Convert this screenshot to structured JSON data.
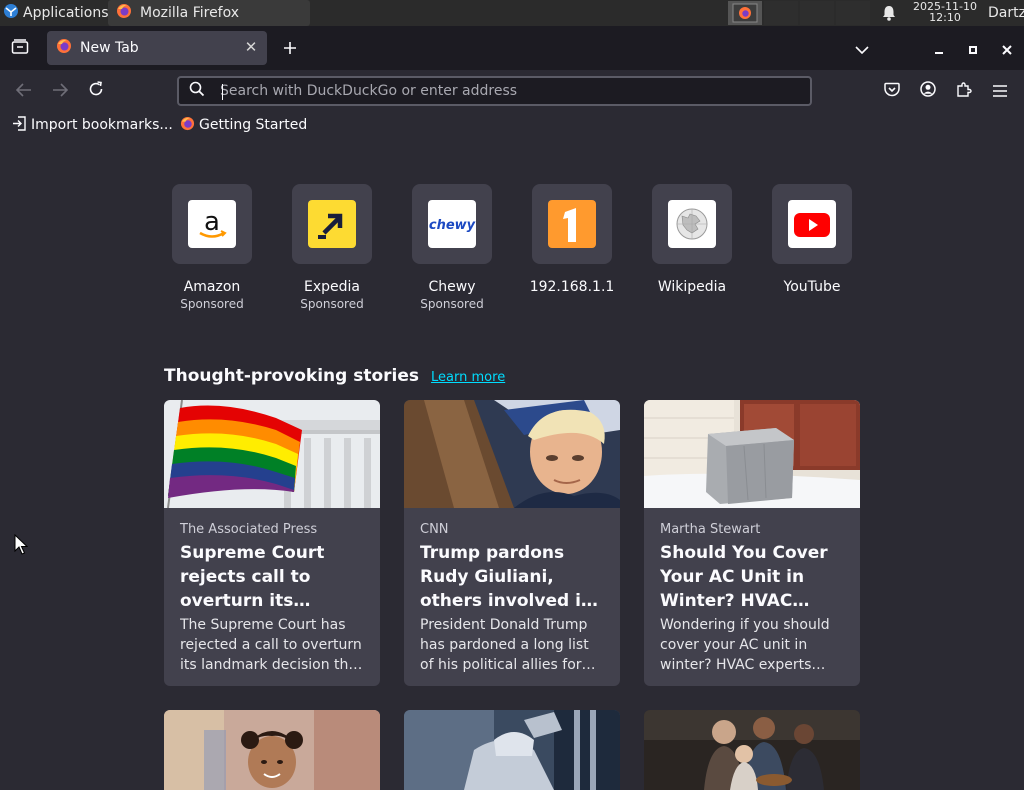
{
  "system_panel": {
    "applications_label": "Applications",
    "taskbar_window_title": "Mozilla Firefox",
    "clock_date": "2025-11-10",
    "clock_time": "12:10",
    "user_name": "Dartz"
  },
  "tab_strip": {
    "active_tab_title": "New Tab"
  },
  "navbar": {
    "url_placeholder": "Search with DuckDuckGo or enter address",
    "url_value": ""
  },
  "bookmarks": [
    {
      "label": "Import bookmarks...",
      "icon": "import-icon"
    },
    {
      "label": "Getting Started",
      "icon": "firefox-icon"
    }
  ],
  "top_sites": [
    {
      "label": "Amazon",
      "sub": "Sponsored",
      "icon": "amazon-logo"
    },
    {
      "label": "Expedia",
      "sub": "Sponsored",
      "icon": "expedia-logo"
    },
    {
      "label": "Chewy",
      "sub": "Sponsored",
      "icon": "chewy-logo"
    },
    {
      "label": "192.168.1.1",
      "sub": "",
      "icon": "router-logo"
    },
    {
      "label": "Wikipedia",
      "sub": "",
      "icon": "wikipedia-logo"
    },
    {
      "label": "YouTube",
      "sub": "",
      "icon": "youtube-logo"
    }
  ],
  "stories": {
    "heading": "Thought-provoking stories",
    "learn_more": "Learn more",
    "cards": [
      {
        "source": "The Associated Press",
        "title": "Supreme Court rejects call to overturn its…",
        "description": "The Supreme Court has rejected a call to overturn its landmark decision th…"
      },
      {
        "source": "CNN",
        "title": "Trump pardons Rudy Giuliani, others involved i…",
        "description": "President Donald Trump has pardoned a long list of his political allies for…"
      },
      {
        "source": "Martha Stewart",
        "title": "Should You Cover Your AC Unit in Winter? HVAC…",
        "description": "Wondering if you should cover your AC unit in winter? HVAC experts…"
      }
    ]
  },
  "colors": {
    "page_bg": "#2b2a33",
    "tab_strip_bg": "#1c1b22",
    "card_bg": "#42414d",
    "link": "#00ddff"
  }
}
